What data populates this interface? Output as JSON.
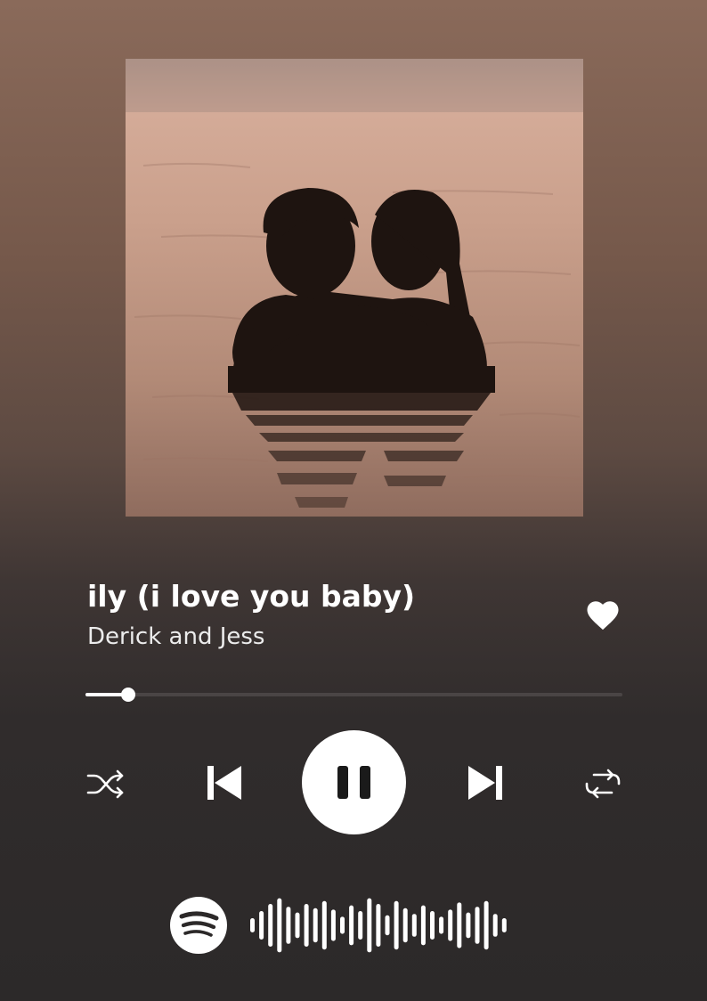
{
  "track": {
    "title": "ily (i love you baby)",
    "artist": "Derick and Jess",
    "liked": true
  },
  "playback": {
    "progress_fraction": 0.08,
    "state": "playing"
  },
  "controls": {
    "shuffle_icon": "shuffle-icon",
    "previous_icon": "skip-previous-icon",
    "pause_icon": "pause-icon",
    "next_icon": "skip-next-icon",
    "repeat_icon": "repeat-icon",
    "like_icon": "heart-icon"
  },
  "branding": {
    "logo_icon": "spotify-logo-icon",
    "code_icon": "spotify-code-bars",
    "code_bar_levels": [
      0.25,
      0.5,
      0.75,
      0.95,
      0.65,
      0.45,
      0.75,
      0.6,
      0.85,
      0.55,
      0.3,
      0.7,
      0.5,
      0.95,
      0.75,
      0.35,
      0.85,
      0.6,
      0.4,
      0.7,
      0.5,
      0.3,
      0.55,
      0.8,
      0.45,
      0.65,
      0.85,
      0.4,
      0.25
    ]
  },
  "colors": {
    "background_top": "#8a6a5a",
    "background_bottom": "#2c2929",
    "foreground": "#ffffff",
    "track_inactive": "#4a4545"
  }
}
